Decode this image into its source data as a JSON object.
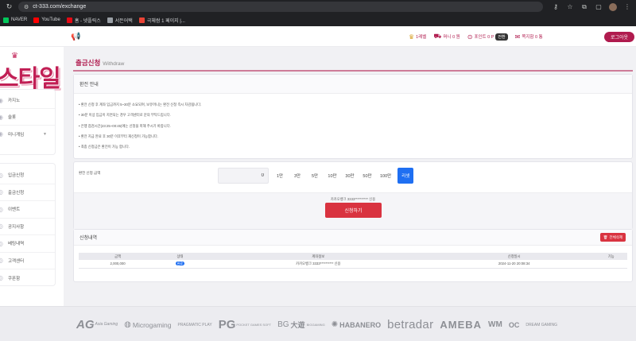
{
  "browser": {
    "url": "ct-333.com/exchange",
    "bookmarks": [
      {
        "label": "NAVER",
        "color": "#03c75a"
      },
      {
        "label": "YouTube",
        "color": "#ff0000"
      },
      {
        "label": "홈 - 넷플릭스",
        "color": "#e50914"
      },
      {
        "label": "서든어택",
        "color": "#9aa0a6"
      },
      {
        "label": "극체쌈 1 페이지 |...",
        "color": "#ea4335"
      }
    ]
  },
  "header": {
    "items": [
      {
        "icon": "trophy-icon",
        "label": "1레벨",
        "extra": "",
        "pill": ""
      },
      {
        "icon": "cash-icon",
        "label": "머니 0 원",
        "extra": "",
        "pill": ""
      },
      {
        "icon": "point-icon",
        "label": "포인트 0 P",
        "extra": "",
        "pill": "전환"
      },
      {
        "icon": "mail-icon",
        "label": "쪽지함 0 통",
        "extra": "",
        "pill": ""
      }
    ],
    "logout_label": "로그아웃"
  },
  "sidebar": {
    "logo_text": "스타일",
    "logo_crown": "♛",
    "menu_top": [
      {
        "label": "카지노",
        "icon": "casino-icon",
        "has_caret": false
      },
      {
        "label": "슬롯",
        "icon": "slot-icon",
        "has_caret": false
      },
      {
        "label": "미니게임",
        "icon": "minigame-icon",
        "has_caret": true
      }
    ],
    "menu_bottom": [
      {
        "label": "입금신청",
        "icon": "deposit-icon"
      },
      {
        "label": "출금신청",
        "icon": "withdraw-icon"
      },
      {
        "label": "이벤트",
        "icon": "event-icon"
      },
      {
        "label": "공지사항",
        "icon": "notice-icon"
      },
      {
        "label": "베팅내역",
        "icon": "history-icon"
      },
      {
        "label": "고객센터",
        "icon": "support-icon"
      },
      {
        "label": "쿠폰함",
        "icon": "coupon-icon"
      }
    ]
  },
  "page": {
    "title": "출금신청",
    "subtitle": "Withdraw"
  },
  "notice": {
    "title": "환전 안내",
    "lines": [
      "• 환전 신청 후 계좌 입금까지 5~30분 소요되며, 보유머니는 환전 신청 즉시 차감됩니다.",
      "• 30분 이상 입금이 지연되는 경우 고객센터로 문의 부탁드립니다.",
      "• 은행 점검시간(23:25~00:45)에는 신청을 피해 주시기 바랍니다.",
      "• 환전 지급 완료 후 30분 이후부터 재신청이 가능합니다.",
      "• 최종 신청금은 환전이 가능 합니다."
    ]
  },
  "form": {
    "label": "환전 신청 금액",
    "amount_value": "0",
    "amount_buttons": [
      "1만",
      "3만",
      "5만",
      "10만",
      "30만",
      "50만",
      "100만"
    ],
    "reset_label": "리셋",
    "account_note": "카카오뱅크 3333********** 신용",
    "submit_label": "신청하기"
  },
  "history": {
    "title": "신청내역",
    "delete_all_label": "전체삭제",
    "columns": [
      "금액",
      "상태",
      "계좌정보",
      "신청일시",
      "기능"
    ],
    "rows": [
      {
        "amount": "2,000,000",
        "status": "완료",
        "account": "카카오뱅크 3333********** 신용",
        "date": "2024-11-20 20:08:34",
        "action": ""
      }
    ]
  },
  "footer": {
    "providers": [
      "AG",
      "Asia Gaming",
      "Microgaming",
      "PRAGMATIC PLAY",
      "PG",
      "POCKET GAMES SOFT",
      "BG",
      "大遊",
      "BIGGAMING",
      "HABANERO",
      "betradar",
      "AMEBA",
      "WM",
      "OC",
      "DREAM GAMING"
    ]
  }
}
